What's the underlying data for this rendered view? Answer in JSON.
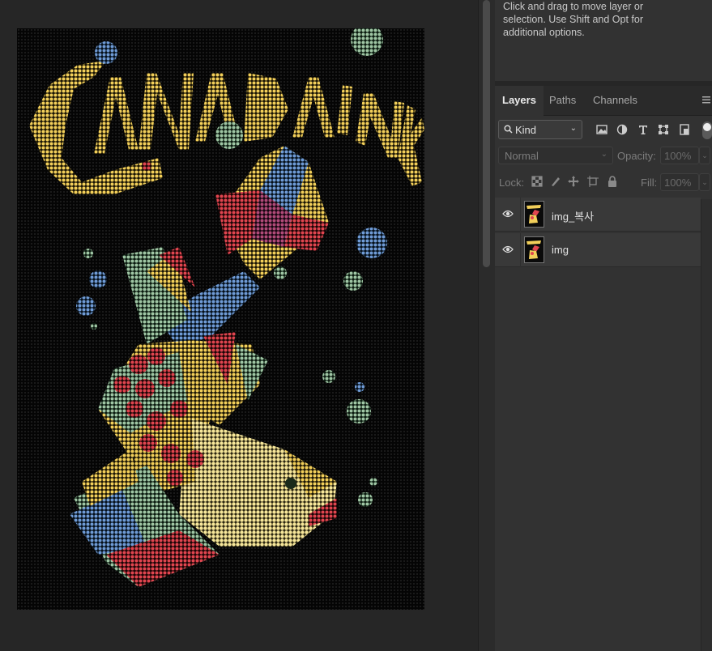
{
  "tooltip": {
    "text": "Click and drag to move layer or\nselection.  Use Shift and Opt for\nadditional options."
  },
  "canvas": {
    "artwork_title_text": "CANADAINK"
  },
  "layers_panel": {
    "tabs": [
      {
        "label": "Layers",
        "active": true
      },
      {
        "label": "Paths",
        "active": false
      },
      {
        "label": "Channels",
        "active": false
      }
    ],
    "filter": {
      "kind_label": "Kind"
    },
    "blend_mode": "Normal",
    "opacity_label": "Opacity:",
    "opacity_value": "100%",
    "lock_label": "Lock:",
    "fill_label": "Fill:",
    "fill_value": "100%",
    "layers": [
      {
        "name": "img_복사",
        "visible": true
      },
      {
        "name": "img",
        "visible": true
      }
    ]
  },
  "colors": {
    "panel_bg": "#323232",
    "canvas_bg": "#262626",
    "art_yellow": "#f2cf5a",
    "art_red": "#e0454f",
    "art_blue": "#6f9bd6",
    "art_green": "#9fc6a4"
  }
}
